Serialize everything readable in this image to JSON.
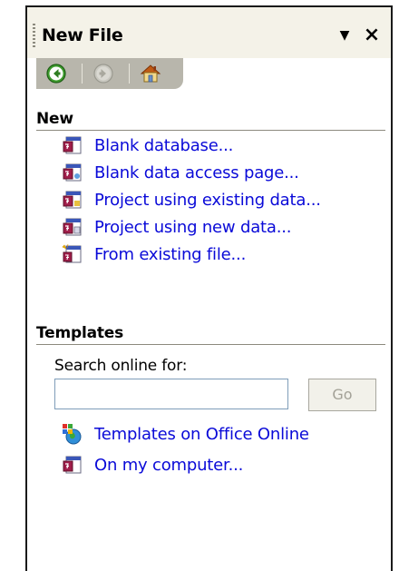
{
  "pane": {
    "title": "New File",
    "menu_arrow_glyph": "▼",
    "close_glyph": "×"
  },
  "sections": {
    "new": {
      "heading": "New",
      "items": [
        {
          "label": "Blank database...",
          "icon": "database-icon"
        },
        {
          "label": "Blank data access page...",
          "icon": "data-access-page-icon"
        },
        {
          "label": "Project using existing data...",
          "icon": "project-existing-icon"
        },
        {
          "label": "Project using new data...",
          "icon": "project-new-icon"
        },
        {
          "label": "From existing file...",
          "icon": "existing-file-icon"
        }
      ]
    },
    "templates": {
      "heading": "Templates",
      "search_label": "Search online for:",
      "search_value": "",
      "go_label": "Go",
      "items": [
        {
          "label": "Templates on Office Online",
          "icon": "office-online-globe-icon"
        },
        {
          "label": "On my computer...",
          "icon": "computer-templates-icon"
        }
      ]
    }
  },
  "colors": {
    "link": "#0a0ad8",
    "titlebar": "#f4f2e8",
    "navbar": "#b8b6ac",
    "nav_back_green": "#3e9c2e"
  }
}
